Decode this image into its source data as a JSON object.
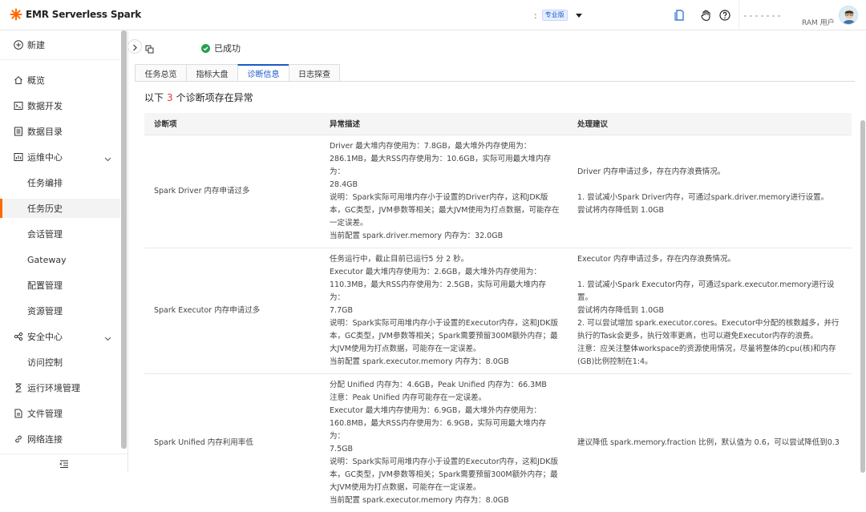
{
  "app": {
    "title": "EMR Serverless Spark",
    "edition_prefix": ":",
    "edition_badge": "专业版",
    "user_role": "RAM 用户",
    "brand_color": "#ff6a00",
    "accent_color": "#1b58c8"
  },
  "sidebar": {
    "new_label": "新建",
    "items": [
      {
        "label": "概览",
        "icon": "home-icon"
      },
      {
        "label": "数据开发",
        "icon": "terminal-icon"
      },
      {
        "label": "数据目录",
        "icon": "catalog-icon"
      },
      {
        "label": "运维中心",
        "icon": "ops-icon",
        "expanded": true
      },
      {
        "label": "任务编排"
      },
      {
        "label": "任务历史",
        "active": true
      },
      {
        "label": "会话管理"
      },
      {
        "label": "Gateway"
      },
      {
        "label": "配置管理"
      },
      {
        "label": "资源管理"
      },
      {
        "label": "安全中心",
        "icon": "security-icon",
        "expanded": true
      },
      {
        "label": "访问控制"
      },
      {
        "label": "运行环境管理",
        "icon": "hourglass-icon"
      },
      {
        "label": "文件管理",
        "icon": "file-icon"
      },
      {
        "label": "网络连接",
        "icon": "link-icon"
      }
    ]
  },
  "main": {
    "status": "已成功",
    "tabs": [
      "任务总览",
      "指标大盘",
      "诊断信息",
      "日志探查"
    ],
    "active_tab": "诊断信息",
    "headline_prefix": "以下",
    "headline_count": "3",
    "headline_suffix": "个诊断项存在异常",
    "table": {
      "headers": [
        "诊断项",
        "异常描述",
        "处理建议"
      ],
      "rows": [
        {
          "item": "Spark Driver 内存申请过多",
          "desc": [
            "Driver 最大堆内存使用为：7.8GB，最大堆外内存使用为：",
            "286.1MB，最大RSS内存使用为：10.6GB，实际可用最大堆内存为：",
            "28.4GB",
            "说明：Spark实际可用堆内存小于设置的Driver内存，这和JDK版本，GC类型，JVM参数等相关；最大JVM使用为打点数据，可能存在一定误差。",
            "当前配置 spark.driver.memory 内存为：32.0GB"
          ],
          "sugg": [
            "Driver 内存申请过多，存在内存浪费情况。",
            "",
            "1. 尝试减小Spark Driver内存，可通过spark.driver.memory进行设置。",
            "尝试将内存降低到 1.0GB"
          ]
        },
        {
          "item": "Spark Executor 内存申请过多",
          "desc": [
            "任务运行中，截止目前已运行5 分 2 秒。",
            "Executor 最大堆内存使用为：2.6GB，最大堆外内存使用为：",
            "110.3MB，最大RSS内存使用为：2.5GB，实际可用最大堆内存为：",
            "7.7GB",
            "说明：Spark实际可用堆内存小于设置的Executor内存，这和JDK版本，GC类型，JVM参数等相关；Spark需要预留300M额外内存；最大JVM使用为打点数据，可能存在一定误差。",
            "当前配置 spark.executor.memory 内存为：8.0GB"
          ],
          "sugg": [
            "Executor 内存申请过多，存在内存浪费情况。",
            "",
            "1. 尝试减小Spark Executor内存，可通过spark.executor.memory进行设置。",
            "尝试将内存降低到 1.0GB",
            "2. 可以尝试增加 spark.executor.cores。Executor中分配的核数越多，并行执行的Task会更多，执行效率更高，也可以避免Executor内存的浪费。",
            "注意：应关注整体workspace的资源使用情况，尽量将整体的cpu(核)和内存(GB)比例控制在1:4。"
          ]
        },
        {
          "item": "Spark Unified 内存利用率低",
          "desc": [
            "分配 Unified 内存为：4.6GB，Peak Unified 内存为：66.3MB",
            "注意：Peak Unified 内存可能存在一定误差。",
            "Executor 最大堆内存使用为：6.9GB，最大堆外内存使用为：",
            "160.8MB，最大RSS内存使用为：6.9GB，实际可用最大堆内存为：",
            "7.5GB",
            "说明：Spark实际可用堆内存小于设置的Executor内存，这和JDK版本，GC类型，JVM参数等相关；Spark需要预留300M额外内存；最大JVM使用为打点数据，可能存在一定误差。",
            "当前配置 spark.executor.memory 内存为：8.0GB"
          ],
          "sugg": [
            "建议降低 spark.memory.fraction 比例，默认值为 0.6，可以尝试降低到0.3"
          ]
        }
      ]
    }
  }
}
